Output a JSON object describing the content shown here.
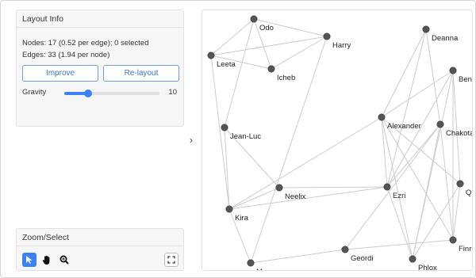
{
  "layout_info": {
    "title": "Layout Info",
    "nodes_text": "Nodes: 17 (0.52 per edge); 0 selected",
    "edges_text": "Edges: 33 (1.94 per node)",
    "improve_label": "Improve",
    "relayout_label": "Re-layout",
    "gravity_label": "Gravity",
    "gravity_value": "10",
    "gravity_fraction": 0.25
  },
  "zoom_select": {
    "title": "Zoom/Select",
    "tools": [
      "pointer-icon",
      "hand-icon",
      "zoom-icon"
    ],
    "active_tool": "pointer-icon",
    "expand_icon": "expand-icon"
  },
  "collapse_toggle": "›",
  "colors": {
    "accent": "#3b82f6",
    "node": "#555555",
    "edge": "#cccccc"
  },
  "graph": {
    "nodes": [
      {
        "id": "Odo",
        "label": "Odo"
      },
      {
        "id": "Harry",
        "label": "Harry"
      },
      {
        "id": "Leeta",
        "label": "Leeta"
      },
      {
        "id": "Icheb",
        "label": "Icheb"
      },
      {
        "id": "Deanna",
        "label": "Deanna"
      },
      {
        "id": "Ben",
        "label": "Ben"
      },
      {
        "id": "Alexander",
        "label": "Alexander"
      },
      {
        "id": "Chakotay",
        "label": "Chakota"
      },
      {
        "id": "JeanLuc",
        "label": "Jean-Luc"
      },
      {
        "id": "Q",
        "label": "Q"
      },
      {
        "id": "Neelix",
        "label": "Neelix"
      },
      {
        "id": "Ezri",
        "label": "Ezri"
      },
      {
        "id": "Kira",
        "label": "Kira"
      },
      {
        "id": "Finn",
        "label": "Finr"
      },
      {
        "id": "Geordi",
        "label": "Geordi"
      },
      {
        "id": "Phlox",
        "label": "Phlox"
      },
      {
        "id": "Morn",
        "label": "Morn"
      }
    ],
    "edges": [
      [
        "Odo",
        "Harry"
      ],
      [
        "Odo",
        "Leeta"
      ],
      [
        "Odo",
        "Icheb"
      ],
      [
        "Odo",
        "JeanLuc"
      ],
      [
        "Leeta",
        "Icheb"
      ],
      [
        "Leeta",
        "Harry"
      ],
      [
        "Icheb",
        "Harry"
      ],
      [
        "Harry",
        "Morn"
      ],
      [
        "Leeta",
        "Kira"
      ],
      [
        "JeanLuc",
        "Neelix"
      ],
      [
        "JeanLuc",
        "Kira"
      ],
      [
        "Kira",
        "Neelix"
      ],
      [
        "Kira",
        "Alexander"
      ],
      [
        "Kira",
        "Ezri"
      ],
      [
        "Kira",
        "Morn"
      ],
      [
        "Neelix",
        "Ezri"
      ],
      [
        "Deanna",
        "Alexander"
      ],
      [
        "Deanna",
        "Chakotay"
      ],
      [
        "Deanna",
        "Ezri"
      ],
      [
        "Ben",
        "Alexander"
      ],
      [
        "Ben",
        "Ezri"
      ],
      [
        "Ben",
        "Q"
      ],
      [
        "Ben",
        "Phlox"
      ],
      [
        "Ben",
        "Finn"
      ],
      [
        "Alexander",
        "Ezri"
      ],
      [
        "Alexander",
        "Q"
      ],
      [
        "Alexander",
        "Phlox"
      ],
      [
        "Alexander",
        "Finn"
      ],
      [
        "Chakotay",
        "Ezri"
      ],
      [
        "Chakotay",
        "Geordi"
      ],
      [
        "Chakotay",
        "Phlox"
      ],
      [
        "Chakotay",
        "Finn"
      ],
      [
        "Q",
        "Phlox"
      ],
      [
        "Q",
        "Finn"
      ],
      [
        "Ezri",
        "Phlox"
      ],
      [
        "Morn",
        "Geordi"
      ],
      [
        "Geordi",
        "Finn"
      ]
    ]
  }
}
